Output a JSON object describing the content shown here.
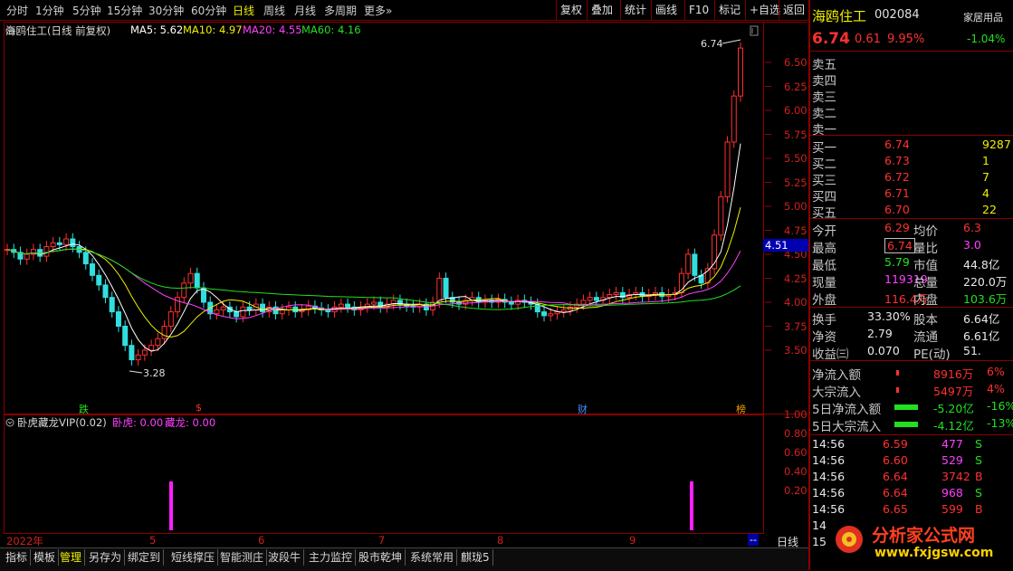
{
  "toolbar": {
    "periods": [
      "分时",
      "1分钟",
      "5分钟",
      "15分钟",
      "30分钟",
      "60分钟",
      "日线",
      "周线",
      "月线",
      "多周期",
      "更多»"
    ],
    "active_period": "日线",
    "right_buttons": [
      "复权",
      "叠加",
      "统计",
      "画线",
      "F10",
      "标记",
      "+自选",
      "返回"
    ]
  },
  "chart_header": {
    "stock": "海鸥住工(日线 前复权)",
    "ma5": "MA5: 5.62",
    "ma10": "MA10: 4.97",
    "ma20": "MA20: 4.55",
    "ma60": "MA60: 4.16",
    "colors": {
      "ma5": "#ffffff",
      "ma10": "#f0f000",
      "ma20": "#ff40ff",
      "ma60": "#20e020",
      "up": "#ff3030",
      "down": "#30e0e0"
    }
  },
  "price_axis": [
    "6.50",
    "6.25",
    "6.00",
    "5.75",
    "5.50",
    "5.25",
    "5.00",
    "4.75",
    "4.50",
    "4.25",
    "4.00",
    "3.75",
    "3.50"
  ],
  "current_price_tag": "4.51",
  "annotations": {
    "high_label": "6.74",
    "low_label": "3.28",
    "marks": [
      "跌",
      "$",
      "财",
      "榜"
    ]
  },
  "indicator": {
    "name": "卧虎藏龙VIP(0.02)",
    "wohu_label": "卧虎: 0.00",
    "canglong_label": "藏龙: 0.00",
    "axis": [
      "1.00",
      "0.80",
      "0.60",
      "0.40",
      "0.20"
    ]
  },
  "date_axis": [
    "2022年",
    "5",
    "6",
    "7",
    "8",
    "9"
  ],
  "corner": {
    "dash": "--",
    "period": "日线"
  },
  "bottom_tabs": [
    "指标",
    "模板",
    "管理",
    "另存为",
    "绑定到",
    "短线撑压",
    "智能测庄",
    "波段牛",
    "主力监控",
    "股市乾坤",
    "系统常用",
    "麒珑5"
  ],
  "active_bottom_tab": "管理",
  "panel": {
    "stock_name": "海鸥住工",
    "code": "002084",
    "industry": "家居用品",
    "price": "6.74",
    "change": "0.61",
    "change_pct": "9.95%",
    "sector_pct": "-1.04%",
    "asks": [
      {
        "label": "卖五"
      },
      {
        "label": "卖四"
      },
      {
        "label": "卖三"
      },
      {
        "label": "卖二"
      },
      {
        "label": "卖一"
      }
    ],
    "bids": [
      {
        "label": "买一",
        "price": "6.74",
        "vol": "9287"
      },
      {
        "label": "买二",
        "price": "6.73",
        "vol": "1"
      },
      {
        "label": "买三",
        "price": "6.72",
        "vol": "7"
      },
      {
        "label": "买四",
        "price": "6.71",
        "vol": "4"
      },
      {
        "label": "买五",
        "price": "6.70",
        "vol": "22"
      }
    ],
    "stats": [
      {
        "l1": "今开",
        "v1": "6.29",
        "l2": "均价",
        "v2": "6.3"
      },
      {
        "l1": "最高",
        "v1": "6.74",
        "l2": "量比",
        "v2": "3.0"
      },
      {
        "l1": "最低",
        "v1": "5.79",
        "l2": "市值",
        "v2": "44.8亿"
      },
      {
        "l1": "现量",
        "v1": "119319",
        "l2": "总量",
        "v2": "220.0万"
      },
      {
        "l1": "外盘",
        "v1": "116.4万",
        "l2": "内盘",
        "v2": "103.6万"
      }
    ],
    "fund": [
      {
        "l1": "换手",
        "v1": "33.30%",
        "l2": "股本",
        "v2": "6.64亿"
      },
      {
        "l1": "净资",
        "v1": "2.79",
        "l2": "流通",
        "v2": "6.61亿"
      },
      {
        "l1": "收益㈢",
        "v1": "0.070",
        "l2": "PE(动)",
        "v2": "51."
      }
    ],
    "flows": [
      {
        "label": "净流入额",
        "value": "8916万",
        "pct": "6%"
      },
      {
        "label": "大宗流入",
        "value": "5497万",
        "pct": "4%"
      },
      {
        "label": "5日净流入额",
        "value": "-5.20亿",
        "pct": "-16%"
      },
      {
        "label": "5日大宗流入",
        "value": "-4.12亿",
        "pct": "-13%"
      }
    ],
    "ticks": [
      {
        "time": "14:56",
        "price": "6.59",
        "vol": "477",
        "side": "S"
      },
      {
        "time": "14:56",
        "price": "6.60",
        "vol": "529",
        "side": "S"
      },
      {
        "time": "14:56",
        "price": "6.64",
        "vol": "3742",
        "side": "B"
      },
      {
        "time": "14:56",
        "price": "6.64",
        "vol": "968",
        "side": "S"
      },
      {
        "time": "14:56",
        "price": "6.65",
        "vol": "599",
        "side": "B"
      }
    ],
    "tick_tail": [
      "14",
      "15"
    ]
  },
  "watermark": {
    "name": "分析家公式网",
    "url": "www.fxjgsw.com"
  }
}
